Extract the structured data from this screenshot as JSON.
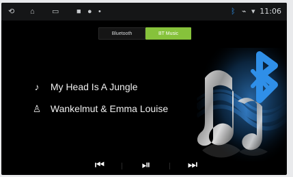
{
  "status": {
    "time": "11:06",
    "icons": [
      "back-icon",
      "home-icon",
      "recent-apps-icon",
      "notification-icon",
      "bluetooth-status-icon",
      "wifi-icon",
      "signal-icon"
    ]
  },
  "tabs": [
    {
      "label": "Bluetooth"
    },
    {
      "label": "BT Music"
    }
  ],
  "track": {
    "title": "My Head Is A Jungle",
    "artist": "Wankelmut & Emma Louise"
  },
  "theme": {
    "accent": "#86c23b",
    "bluetooth_blue": "#2f8fe8"
  }
}
